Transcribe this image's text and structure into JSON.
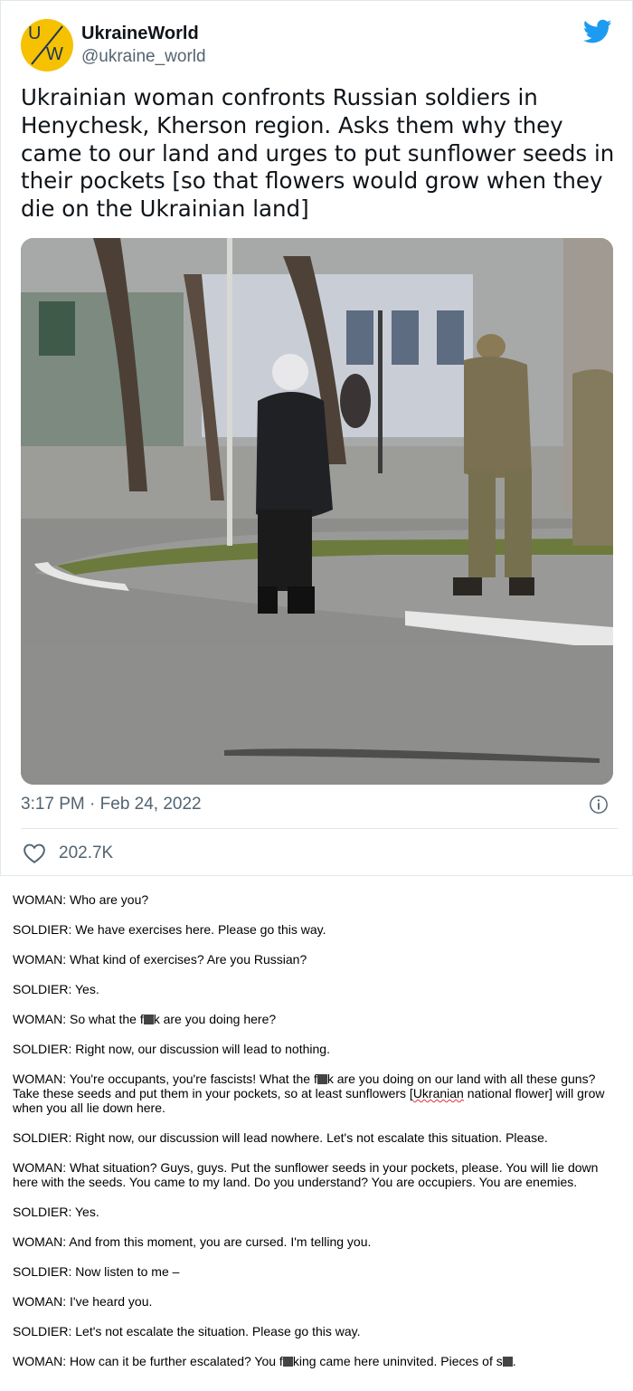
{
  "tweet": {
    "avatar_letters": [
      "U",
      "W"
    ],
    "display_name": "UkraineWorld",
    "handle": "@ukraine_world",
    "text": "Ukrainian woman confronts Russian soldiers in Henychesk, Kherson region. Asks them why they came to our land and urges to put sunflower seeds in their pockets [so that flowers would grow when they die on the Ukrainian land]",
    "timestamp": "3:17 PM · Feb 24, 2022",
    "like_count": "202.7K",
    "icons": [
      "twitter-bird-icon",
      "info-icon",
      "heart-icon"
    ],
    "colors": {
      "brand": "#1d9bf0",
      "avatar_bg": "#f5c100",
      "muted": "#536471"
    }
  },
  "transcript": {
    "lines": [
      {
        "speaker": "WOMAN:",
        "text": "Who are you?"
      },
      {
        "speaker": "SOLDIER:",
        "text": "We have exercises here. Please go this way."
      },
      {
        "speaker": "WOMAN:",
        "text": "What kind of exercises? Are you Russian?"
      },
      {
        "speaker": "SOLDIER:",
        "text": "Yes."
      },
      {
        "speaker": "WOMAN:",
        "text_a": "So what the f",
        "text_b": "k are you doing here?"
      },
      {
        "speaker": "SOLDIER:",
        "text": "Right now, our discussion will lead to nothing."
      },
      {
        "speaker": "WOMAN:",
        "text_a": "You're occupants, you're fascists! What the f",
        "text_b": "k are you doing on our land with all these guns? Take these seeds and put them in your pockets, so at least sunflowers [",
        "text_c": "Ukranian",
        "text_d": " national flower] will grow when you all lie down here."
      },
      {
        "speaker": "SOLDIER:",
        "text": "Right now, our discussion will lead nowhere. Let's not escalate this situation. Please."
      },
      {
        "speaker": "WOMAN:",
        "text": "What situation? Guys, guys. Put the sunflower seeds in your pockets, please. You will lie down here with the seeds. You came to my land. Do you understand? You are occupiers. You are enemies."
      },
      {
        "speaker": "SOLDIER:",
        "text": "Yes."
      },
      {
        "speaker": "WOMAN:",
        "text": "And from this moment, you are cursed. I'm telling you."
      },
      {
        "speaker": "SOLDIER:",
        "text": "Now listen to me –"
      },
      {
        "speaker": "WOMAN:",
        "text": "I've heard you."
      },
      {
        "speaker": "SOLDIER:",
        "text": "Let's not escalate the situation. Please go this way."
      },
      {
        "speaker": "WOMAN:",
        "text_a": "How can it be further escalated? You f",
        "text_b": "king came here uninvited. Pieces of s",
        "text_c": "."
      }
    ]
  }
}
